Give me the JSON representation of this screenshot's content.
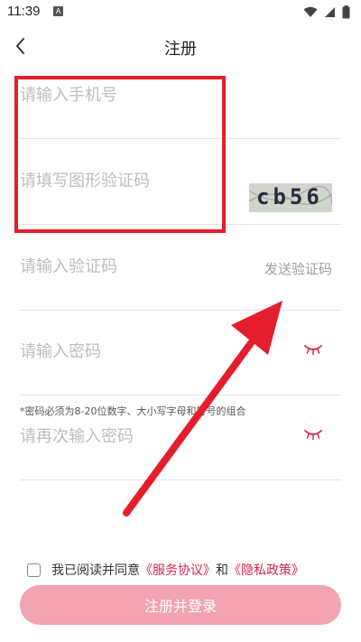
{
  "status": {
    "time": "11:39",
    "notif": "A"
  },
  "header": {
    "title": "注册"
  },
  "fields": {
    "phone_placeholder": "请输入手机号",
    "captcha_placeholder": "请填写图形验证码",
    "captcha_text": "cb56",
    "code_placeholder": "请输入验证码",
    "send_code": "发送验证码",
    "password_placeholder": "请输入密码",
    "password_hint": "*密码必须为8-20位数字、大小写字母和符号的组合",
    "confirm_placeholder": "请再次输入密码"
  },
  "agreement": {
    "prefix": "我已阅读并同意",
    "service": "《服务协议》",
    "and": "和",
    "privacy": "《隐私政策》"
  },
  "submit": {
    "label": "注册并登录"
  },
  "colors": {
    "accent": "#d8234a",
    "button": "#f3a3b1",
    "annotation": "#e41e2b"
  }
}
